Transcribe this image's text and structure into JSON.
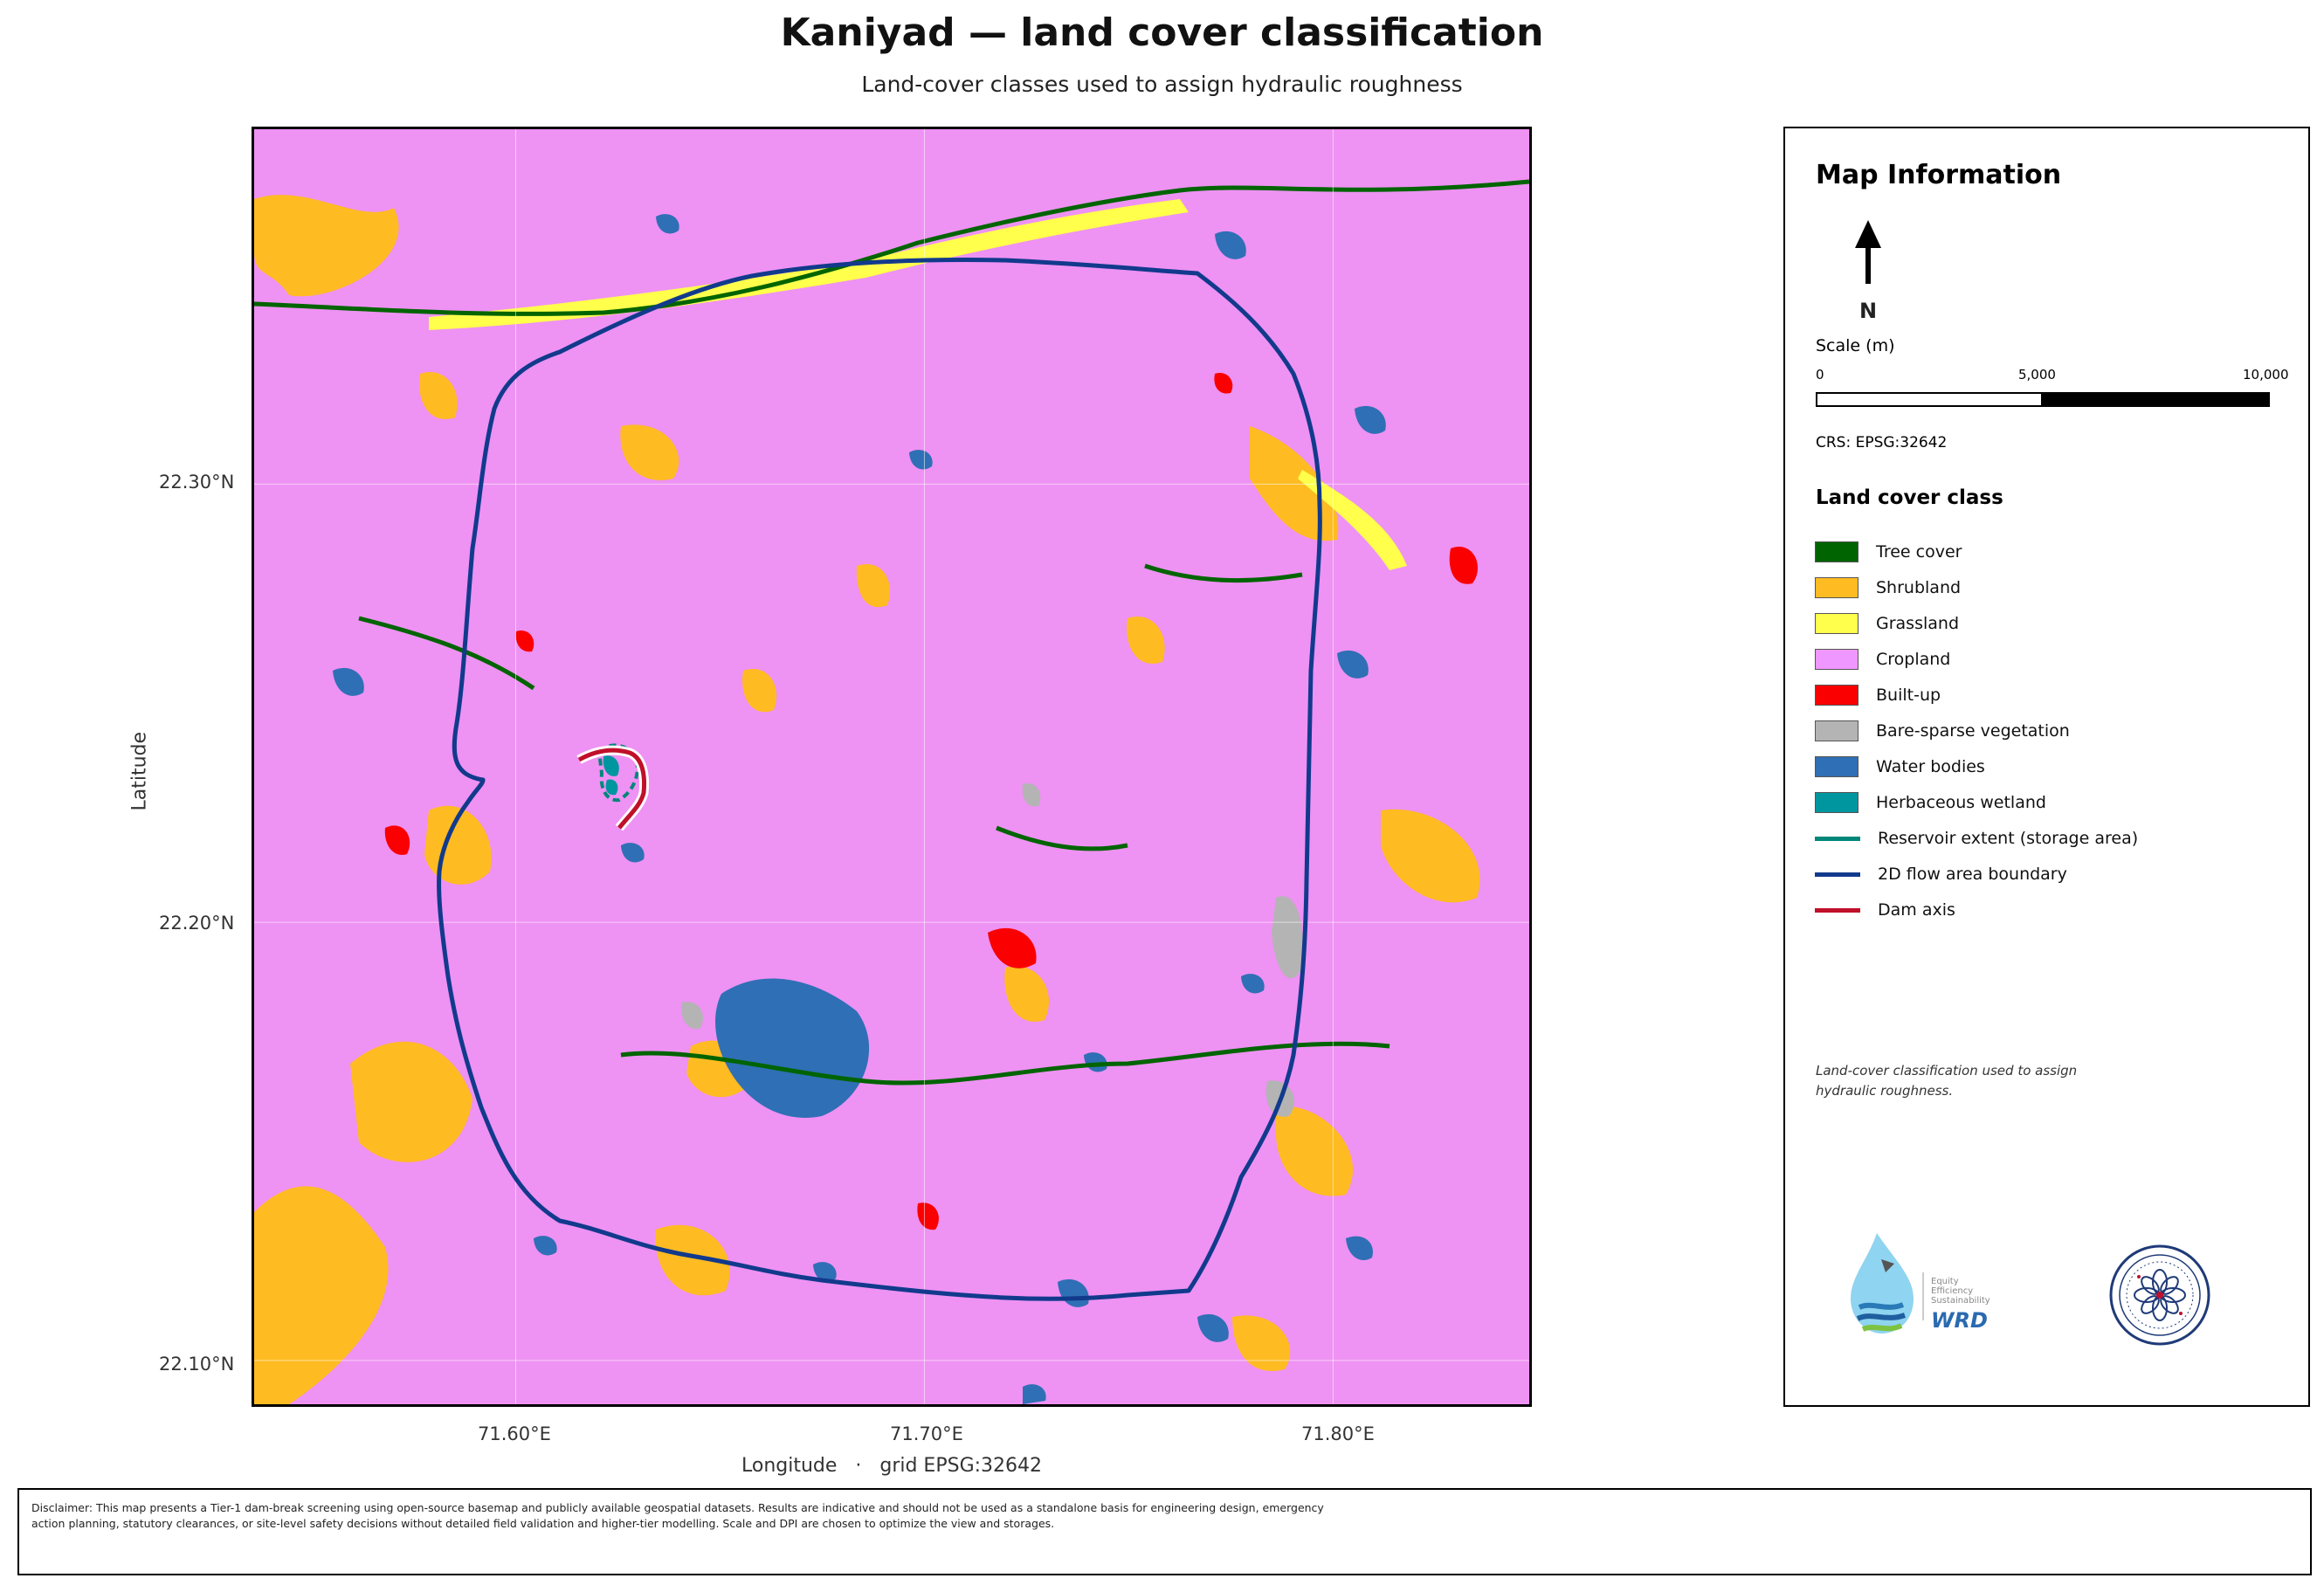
{
  "title": "Kaniyad — land cover classification",
  "subtitle": "Land-cover classes used to assign hydraulic roughness",
  "map": {
    "x_ticks": [
      "71.60°E",
      "71.70°E",
      "71.80°E"
    ],
    "y_ticks": [
      "22.30°N",
      "22.20°N",
      "22.10°N"
    ],
    "xlabel": "Longitude   ·   grid EPSG:32642",
    "ylabel": "Latitude",
    "extent": {
      "lon": [
        71.536,
        71.848
      ],
      "lat": [
        22.09,
        22.381
      ]
    },
    "colors": {
      "tree": "#006400",
      "shrub": "#ffbb22",
      "grass": "#ffff4c",
      "crop": "#f096ff",
      "builtup": "#fa0000",
      "bare": "#b4b4b4",
      "water": "#2f6fb5",
      "wetland": "#0096a0",
      "reservoir": "#00877a",
      "boundary": "#123a8c",
      "dam": "#c0102a"
    }
  },
  "panel": {
    "title": "Map Information",
    "north": "N",
    "scale_title": "Scale (m)",
    "scale_labels": [
      "0",
      "5,000",
      "10,000"
    ],
    "crs": "CRS: EPSG:32642",
    "legend_title": "Land cover class",
    "legend": [
      {
        "label": "Tree cover",
        "kind": "patch",
        "color": "#006400"
      },
      {
        "label": "Shrubland",
        "kind": "patch",
        "color": "#ffbb22"
      },
      {
        "label": "Grassland",
        "kind": "patch",
        "color": "#ffff4c"
      },
      {
        "label": "Cropland",
        "kind": "patch",
        "color": "#f096ff"
      },
      {
        "label": "Built-up",
        "kind": "patch",
        "color": "#fa0000"
      },
      {
        "label": "Bare-sparse vegetation",
        "kind": "patch",
        "color": "#b4b4b4"
      },
      {
        "label": "Water bodies",
        "kind": "patch",
        "color": "#2f6fb5"
      },
      {
        "label": "Herbaceous wetland",
        "kind": "patch",
        "color": "#0096a0"
      },
      {
        "label": "Reservoir extent (storage area)",
        "kind": "line",
        "color": "#00877a"
      },
      {
        "label": "2D flow area boundary",
        "kind": "line",
        "color": "#123a8c"
      },
      {
        "label": "Dam axis",
        "kind": "line",
        "color": "#c0102a"
      }
    ],
    "note": "Land-cover classification used to assign hydraulic roughness.",
    "logo_text": [
      "Equity",
      "Efficiency",
      "Sustainability",
      "WRD"
    ]
  },
  "disclaimer": "Disclaimer: This map presents a Tier-1 dam-break screening using open-source basemap and publicly available geospatial datasets. Results are indicative and should not be used as a standalone basis for engineering design, emergency action planning, statutory clearances, or site-level safety decisions without detailed field validation and higher-tier modelling. Scale and DPI are chosen to optimize the view and storages."
}
